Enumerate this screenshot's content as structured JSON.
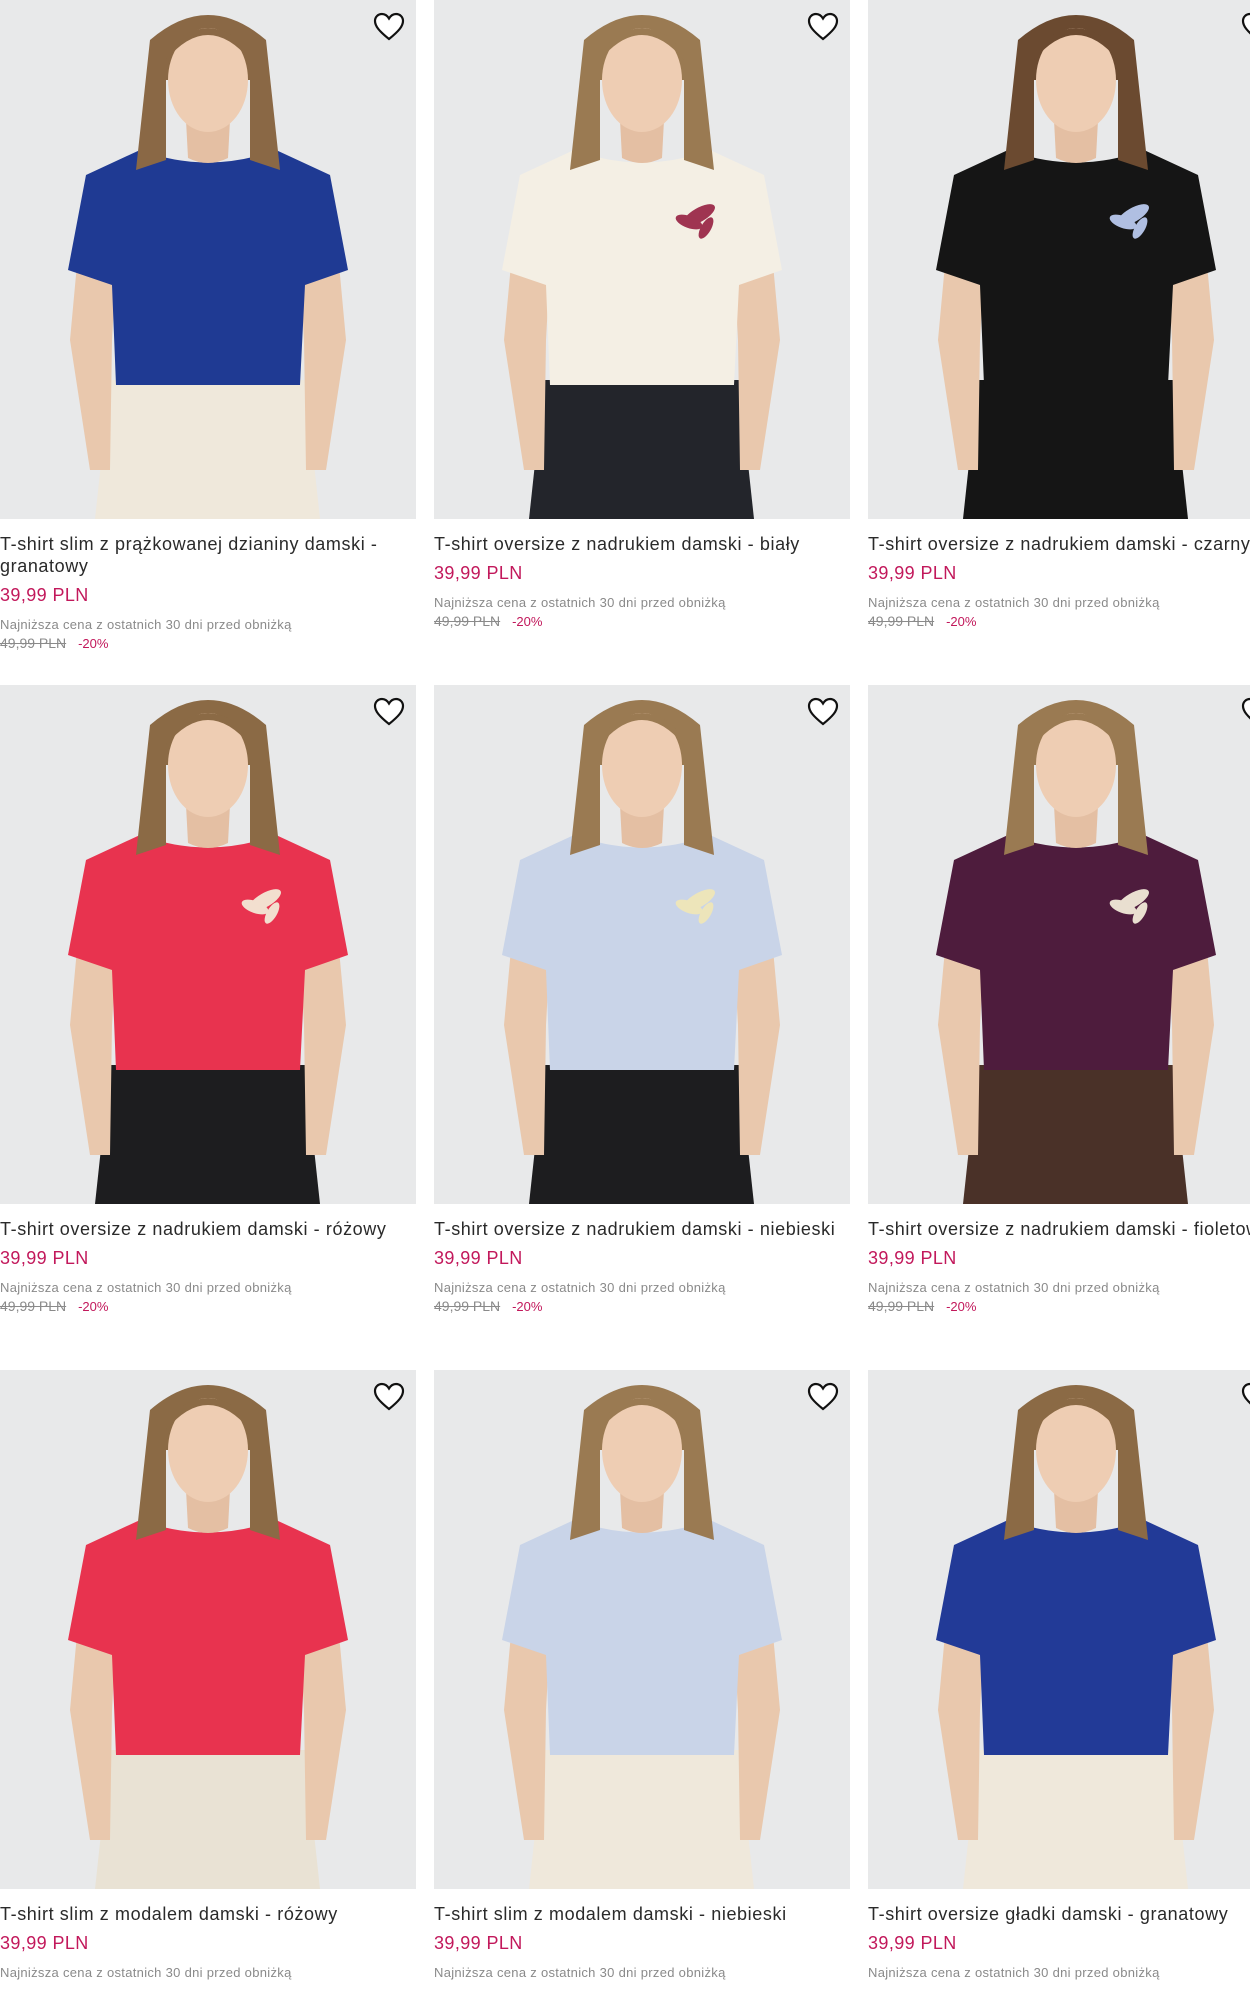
{
  "favorite_icon": "heart-outline-icon",
  "colors": {
    "price": "#c2185b",
    "meta": "#8a8a8a",
    "image_bg": "#e6e7e8"
  },
  "products": [
    {
      "name": "T-shirt slim z prążkowanej dzianiny damski - granatowy",
      "price": "39,99 PLN",
      "lowest_label": "Najniższa cena z ostatnich 30 dni przed obniżką",
      "old_price": "49,99 PLN",
      "discount": "-20%",
      "shirt_color": "#1f3a93",
      "pants_color": "#efe8db",
      "print": "",
      "hair": "#8a6845"
    },
    {
      "name": "T-shirt oversize z nadrukiem damski - biały",
      "price": "39,99 PLN",
      "lowest_label": "Najniższa cena z ostatnich 30 dni przed obniżką",
      "old_price": "49,99 PLN",
      "discount": "-20%",
      "shirt_color": "#f4efe4",
      "pants_color": "#23252b",
      "print": "#9b2a4a",
      "hair": "#9a7a52"
    },
    {
      "name": "T-shirt oversize z nadrukiem damski - czarny",
      "price": "39,99 PLN",
      "lowest_label": "Najniższa cena z ostatnich 30 dni przed obniżką",
      "old_price": "49,99 PLN",
      "discount": "-20%",
      "shirt_color": "#151515",
      "pants_color": "#151515",
      "print": "#b9c9ee",
      "hair": "#6b4a30"
    },
    {
      "name": "T-shirt oversize z nadrukiem damski - różowy",
      "price": "39,99 PLN",
      "lowest_label": "Najniższa cena z ostatnich 30 dni przed obniżką",
      "old_price": "49,99 PLN",
      "discount": "-20%",
      "shirt_color": "#e8334f",
      "pants_color": "#1d1d1f",
      "print": "#f3e9d6",
      "hair": "#8b6a45"
    },
    {
      "name": "T-shirt oversize z nadrukiem damski - niebieski",
      "price": "39,99 PLN",
      "lowest_label": "Najniższa cena z ostatnich 30 dni przed obniżką",
      "old_price": "49,99 PLN",
      "discount": "-20%",
      "shirt_color": "#c9d4e8",
      "pants_color": "#1d1d1f",
      "print": "#efe6b8",
      "hair": "#9a7a52"
    },
    {
      "name": "T-shirt oversize z nadrukiem damski - fioletowy",
      "price": "39,99 PLN",
      "lowest_label": "Najniższa cena z ostatnich 30 dni przed obniżką",
      "old_price": "49,99 PLN",
      "discount": "-20%",
      "shirt_color": "#4e1c3d",
      "pants_color": "#4a3128",
      "print": "#f2ead8",
      "hair": "#9a7a52"
    },
    {
      "name": "T-shirt slim z modalem damski - różowy",
      "price": "39,99 PLN",
      "lowest_label": "Najniższa cena z ostatnich 30 dni przed obniżką",
      "old_price": "",
      "discount": "",
      "shirt_color": "#e8334f",
      "pants_color": "#e9e2d4",
      "print": "",
      "hair": "#8b6a45"
    },
    {
      "name": "T-shirt slim z modalem damski - niebieski",
      "price": "39,99 PLN",
      "lowest_label": "Najniższa cena z ostatnich 30 dni przed obniżką",
      "old_price": "",
      "discount": "",
      "shirt_color": "#c9d4e8",
      "pants_color": "#efe8db",
      "print": "",
      "hair": "#9a7a52"
    },
    {
      "name": "T-shirt oversize gładki damski - granatowy",
      "price": "39,99 PLN",
      "lowest_label": "Najniższa cena z ostatnich 30 dni przed obniżką",
      "old_price": "",
      "discount": "",
      "shirt_color": "#223a97",
      "pants_color": "#efe8db",
      "print": "",
      "hair": "#8b6a45"
    }
  ]
}
